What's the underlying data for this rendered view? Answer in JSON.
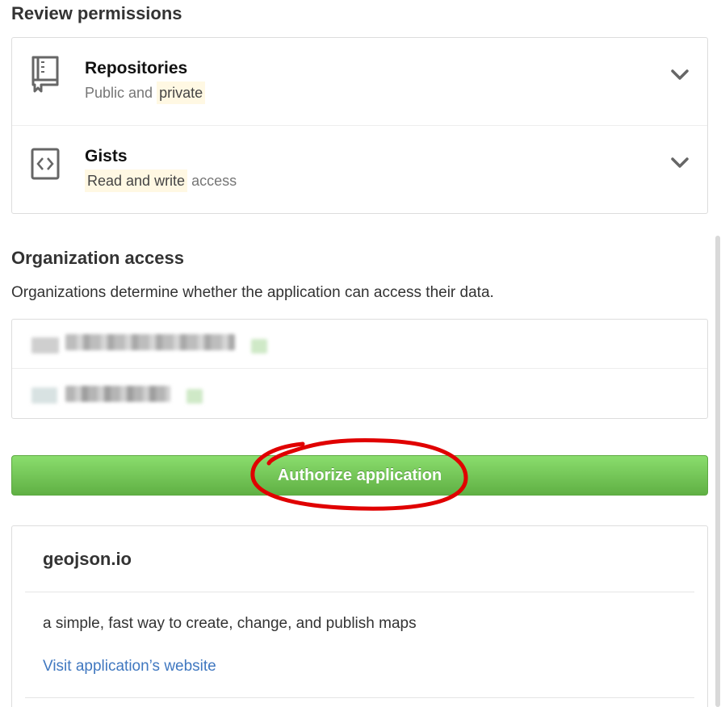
{
  "review": {
    "title": "Review permissions",
    "permissions": [
      {
        "icon": "repo-icon",
        "name": "Repositories",
        "desc_plain": "Public and",
        "desc_highlight": "private"
      },
      {
        "icon": "code-icon",
        "name": "Gists",
        "desc_highlight": "Read and write",
        "desc_plain": "access"
      }
    ]
  },
  "org": {
    "title": "Organization access",
    "description": "Organizations determine whether the application can access their data."
  },
  "authorize": {
    "label": "Authorize application"
  },
  "app": {
    "name": "geojson.io",
    "description": "a simple, fast way to create, change, and publish maps",
    "website_link": "Visit application’s website"
  },
  "colors": {
    "button_green": "#60b044",
    "link_blue": "#4078c0",
    "highlight": "#fff8e3",
    "annotation_red": "#e00000"
  }
}
